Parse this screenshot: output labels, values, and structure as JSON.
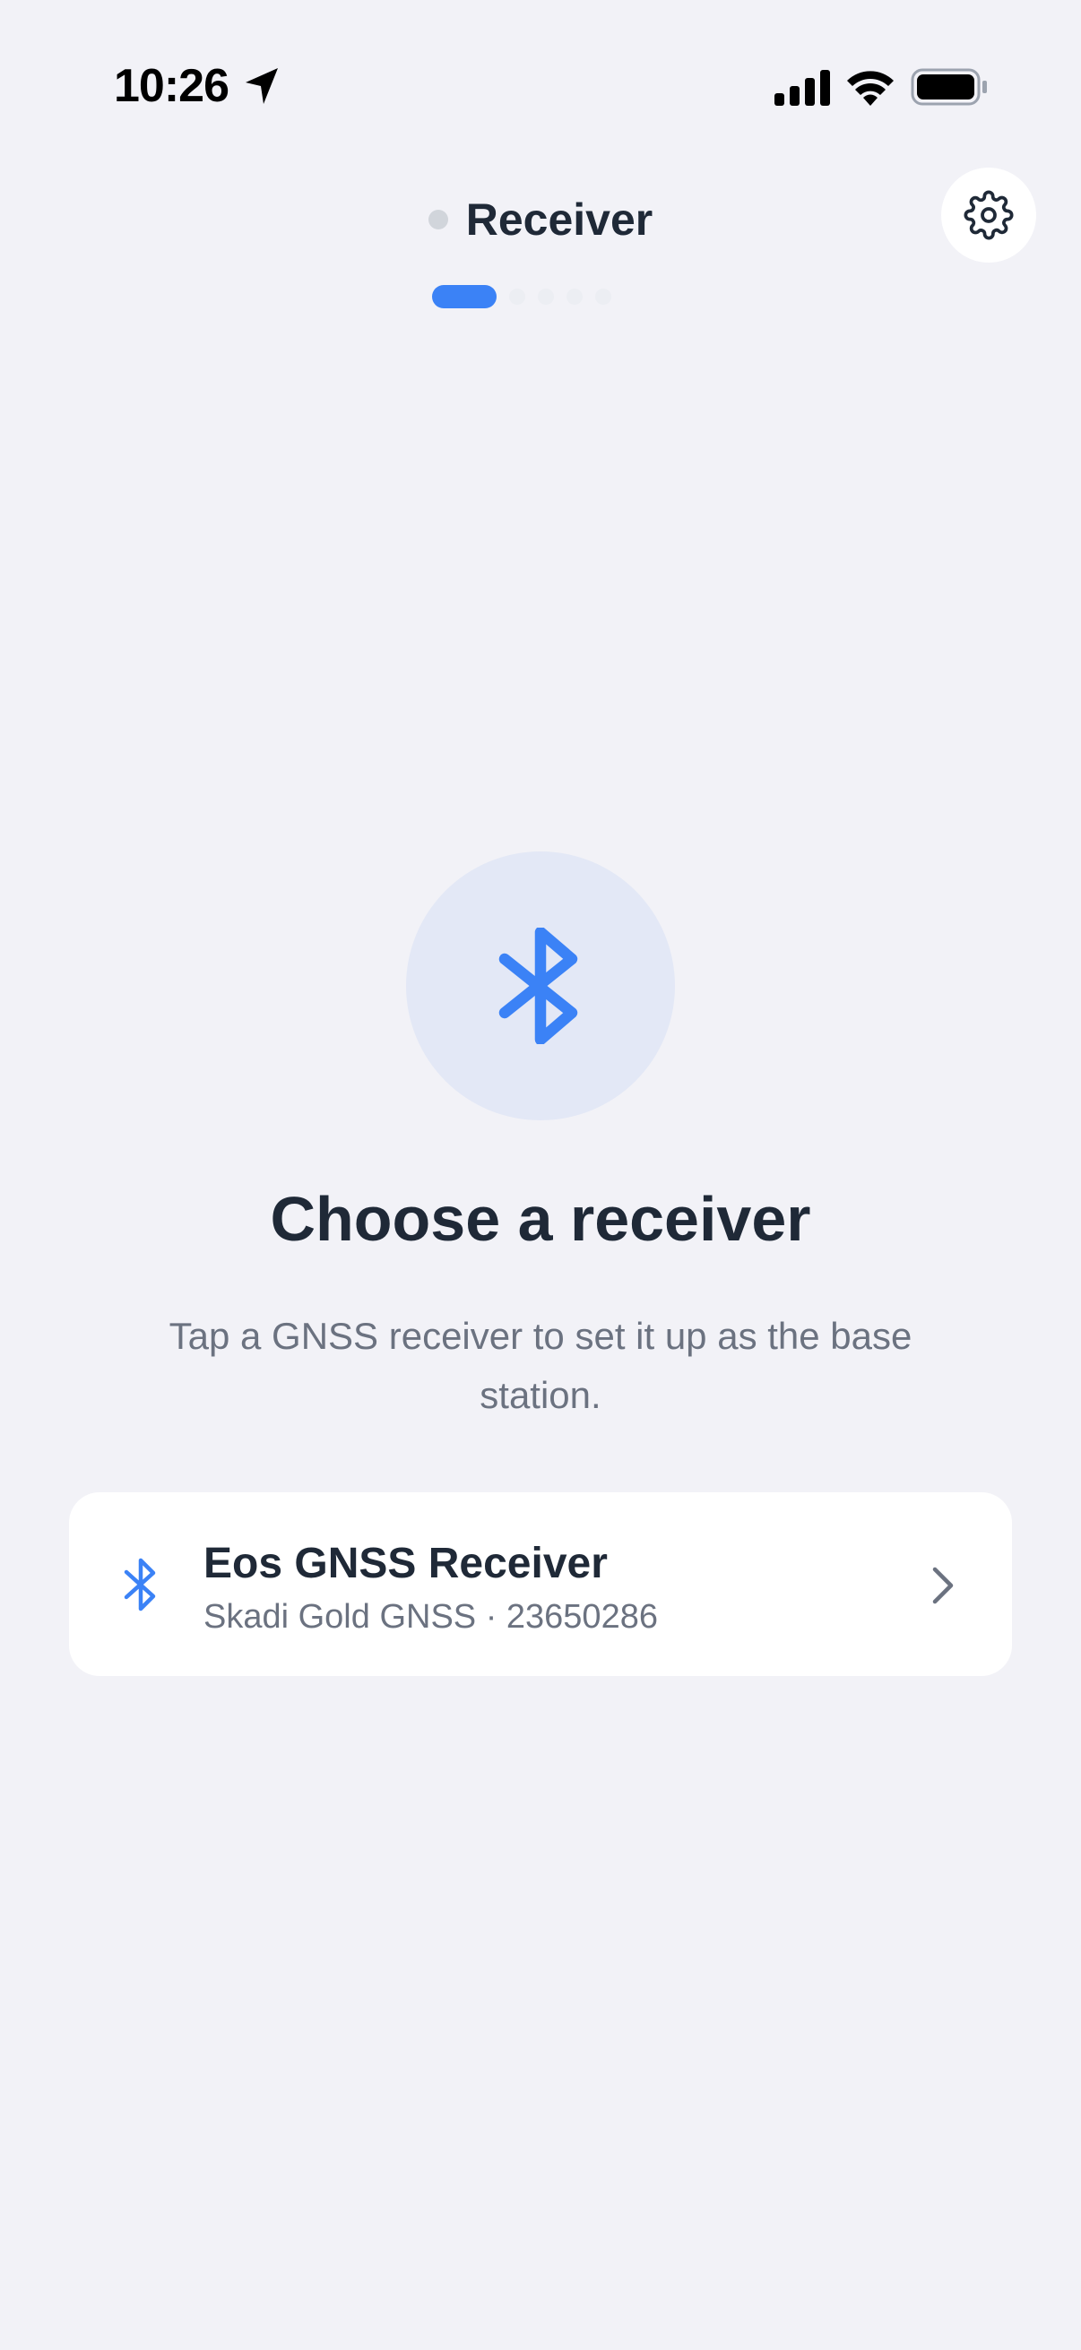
{
  "status_bar": {
    "time": "10:26",
    "icons": [
      "location-arrow-icon",
      "cellular-signal-icon",
      "wifi-icon",
      "battery-icon"
    ]
  },
  "header": {
    "step_title": "Receiver",
    "settings_icon": "gear-icon",
    "progress": {
      "current_step": 1,
      "total_steps": 5
    }
  },
  "hero": {
    "icon": "bluetooth-icon",
    "heading": "Choose a receiver",
    "subtitle": "Tap a GNSS receiver to set it up as the base station."
  },
  "receivers": [
    {
      "name": "Eos GNSS Receiver",
      "detail": "Skadi Gold GNSS · 23650286",
      "icon": "bluetooth-icon"
    }
  ],
  "colors": {
    "background": "#f2f2f7",
    "accent": "#3b82f6",
    "card": "#ffffff",
    "text_primary": "#1f2937",
    "text_secondary": "#6b7280",
    "hero_circle": "#e3e8f6"
  }
}
